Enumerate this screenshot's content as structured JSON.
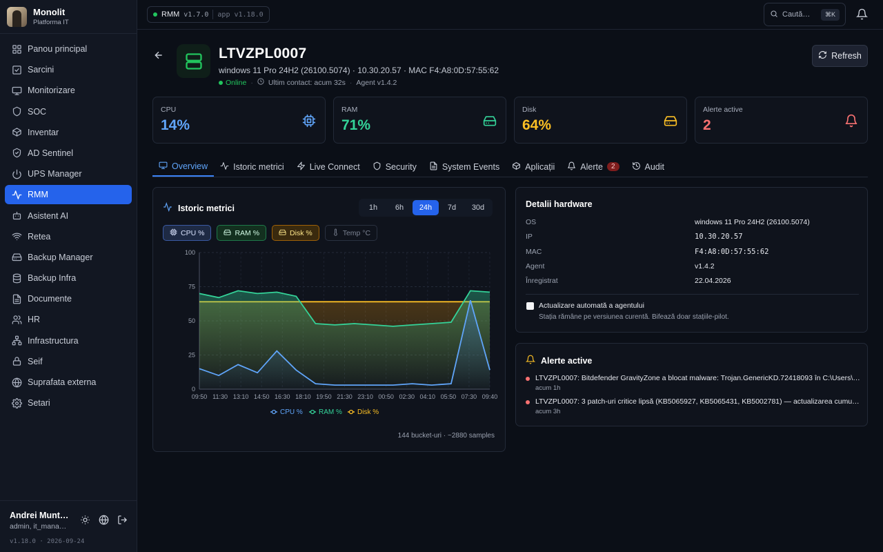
{
  "brand": {
    "title": "Monolit",
    "subtitle": "Platforma IT"
  },
  "sidebar": {
    "items": [
      {
        "label": "Panou principal",
        "icon": "dashboard-icon"
      },
      {
        "label": "Sarcini",
        "icon": "tasks-icon"
      },
      {
        "label": "Monitorizare",
        "icon": "monitor-icon"
      },
      {
        "label": "SOC",
        "icon": "shield-icon"
      },
      {
        "label": "Inventar",
        "icon": "box-icon"
      },
      {
        "label": "AD Sentinel",
        "icon": "shield-check-icon"
      },
      {
        "label": "UPS Manager",
        "icon": "power-icon"
      },
      {
        "label": "RMM",
        "icon": "activity-icon",
        "active": true
      },
      {
        "label": "Asistent AI",
        "icon": "bot-icon"
      },
      {
        "label": "Retea",
        "icon": "wifi-icon"
      },
      {
        "label": "Backup Manager",
        "icon": "hard-drive-icon"
      },
      {
        "label": "Backup Infra",
        "icon": "database-icon"
      },
      {
        "label": "Documente",
        "icon": "file-icon"
      },
      {
        "label": "HR",
        "icon": "users-icon"
      },
      {
        "label": "Infrastructura",
        "icon": "network-icon"
      },
      {
        "label": "Seif",
        "icon": "lock-icon"
      },
      {
        "label": "Suprafata externa",
        "icon": "globe-icon"
      },
      {
        "label": "Setari",
        "icon": "gear-icon"
      }
    ],
    "user": {
      "name": "Andrei Munt…",
      "role": "admin, it_mana…"
    },
    "version": "v1.18.0 · 2026-09-24"
  },
  "topbar": {
    "pill_label": "RMM",
    "pill_version": "v1.7.0",
    "pill_app": "app v1.18.0",
    "search_placeholder": "Caută…",
    "search_kbd": "⌘K"
  },
  "device": {
    "hostname": "LTVZPL0007",
    "meta": "windows 11 Pro 24H2 (26100.5074) · 10.30.20.57 · MAC F4:A8:0D:57:55:62",
    "status": "Online",
    "last_contact": "Ultim contact: acum 32s",
    "agent": "Agent v1.4.2",
    "refresh_label": "Refresh"
  },
  "stats": [
    {
      "label": "CPU",
      "value": "14%",
      "color": "#60a5fa",
      "icon": "cpu-icon"
    },
    {
      "label": "RAM",
      "value": "71%",
      "color": "#34d399",
      "icon": "memory-icon"
    },
    {
      "label": "Disk",
      "value": "64%",
      "color": "#fbbf24",
      "icon": "disk-icon"
    },
    {
      "label": "Alerte active",
      "value": "2",
      "color": "#f87171",
      "icon": "bell-icon"
    }
  ],
  "tabs": [
    {
      "label": "Overview",
      "active": true
    },
    {
      "label": "Istoric metrici"
    },
    {
      "label": "Live Connect"
    },
    {
      "label": "Security"
    },
    {
      "label": "System Events"
    },
    {
      "label": "Aplicații"
    },
    {
      "label": "Alerte",
      "badge": "2"
    },
    {
      "label": "Audit"
    }
  ],
  "chart_panel": {
    "title": "Istoric metrici",
    "ranges": [
      "1h",
      "6h",
      "24h",
      "7d",
      "30d"
    ],
    "active_range": "24h",
    "toggles": [
      "CPU %",
      "RAM %",
      "Disk %",
      "Temp °C"
    ],
    "samples_note": "144 bucket-uri · ~2880 samples"
  },
  "chart_data": {
    "type": "line",
    "x": [
      "09:50",
      "11:30",
      "13:10",
      "14:50",
      "16:30",
      "18:10",
      "19:50",
      "21:30",
      "23:10",
      "00:50",
      "02:30",
      "04:10",
      "05:50",
      "07:30",
      "09:40"
    ],
    "ylim": [
      0,
      100
    ],
    "yticks": [
      0,
      25,
      50,
      75,
      100
    ],
    "grid": true,
    "legend": "bottom",
    "series": [
      {
        "name": "CPU %",
        "color": "#60a5fa",
        "values": [
          15,
          10,
          18,
          12,
          28,
          14,
          4,
          3,
          3,
          3,
          3,
          4,
          3,
          4,
          65,
          14
        ]
      },
      {
        "name": "RAM %",
        "color": "#34d399",
        "values": [
          70,
          67,
          72,
          70,
          71,
          68,
          48,
          47,
          48,
          47,
          46,
          47,
          48,
          49,
          72,
          71
        ]
      },
      {
        "name": "Disk %",
        "color": "#fbbf24",
        "values": [
          64,
          64,
          64,
          64,
          64,
          64,
          64,
          64,
          64,
          64,
          64,
          64,
          64,
          64,
          64,
          64
        ]
      }
    ]
  },
  "hardware": {
    "title": "Detalii hardware",
    "rows": [
      {
        "key": "OS",
        "value": "windows 11 Pro 24H2 (26100.5074)"
      },
      {
        "key": "IP",
        "value": "10.30.20.57"
      },
      {
        "key": "MAC",
        "value": "F4:A8:0D:57:55:62"
      },
      {
        "key": "Agent",
        "value": "v1.4.2"
      },
      {
        "key": "Înregistrat",
        "value": "22.04.2026"
      }
    ],
    "auto_update_label": "Actualizare automată a agentului",
    "auto_update_hint": "Stația rămâne pe versiunea curentă. Bifează doar stațiile-pilot."
  },
  "alerts": {
    "title": "Alerte active",
    "items": [
      {
        "text": "LTVZPL0007: Bitdefender GravityZone a blocat malware: Trojan.GenericKD.72418093 în C:\\Users\\s…",
        "time": "acum 1h"
      },
      {
        "text": "LTVZPL0007: 3 patch-uri critice lipsă (KB5065927, KB5065431, KB5002781) — actualizarea cumulat…",
        "time": "acum 3h"
      }
    ]
  }
}
